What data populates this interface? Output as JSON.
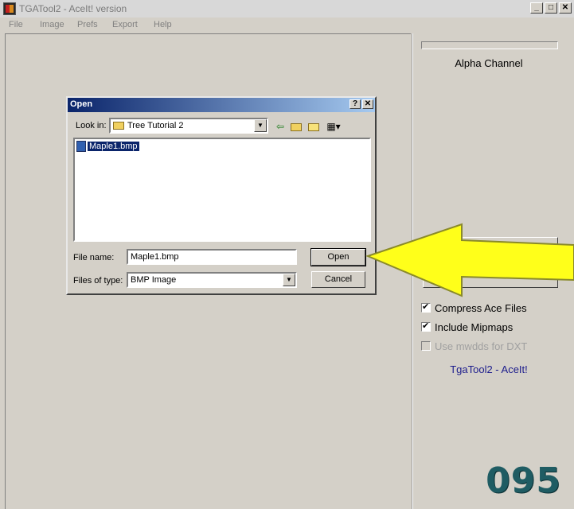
{
  "window": {
    "title": "TGATool2 - AceIt! version",
    "controls": {
      "minimize": "_",
      "maximize": "□",
      "close": "✕"
    }
  },
  "menu": {
    "items": [
      "File",
      "Image",
      "Prefs",
      "Export",
      "Help"
    ]
  },
  "right_panel": {
    "alpha_label": "Alpha Channel",
    "options": [
      {
        "label": "Compress Ace Files",
        "checked": true,
        "enabled": true
      },
      {
        "label": "Include Mipmaps",
        "checked": true,
        "enabled": true
      },
      {
        "label": "Use mwdds for DXT",
        "checked": false,
        "enabled": false
      }
    ],
    "version_label": "TgaTool2 - AceIt!"
  },
  "dialog": {
    "title": "Open",
    "help_glyph": "?",
    "close_glyph": "✕",
    "look_in_label": "Look in:",
    "look_in_value": "Tree Tutorial 2",
    "toolbar_icons": [
      "back-icon",
      "up-folder-icon",
      "new-folder-icon",
      "view-menu-icon"
    ],
    "files": [
      "Maple1.bmp"
    ],
    "file_name_label": "File name:",
    "file_name_value": "Maple1.bmp",
    "file_type_label": "Files of type:",
    "file_type_value": "BMP Image",
    "open_label": "Open",
    "cancel_label": "Cancel"
  },
  "overlay": {
    "counter": "095",
    "arrow_color": "#ffff1a"
  }
}
